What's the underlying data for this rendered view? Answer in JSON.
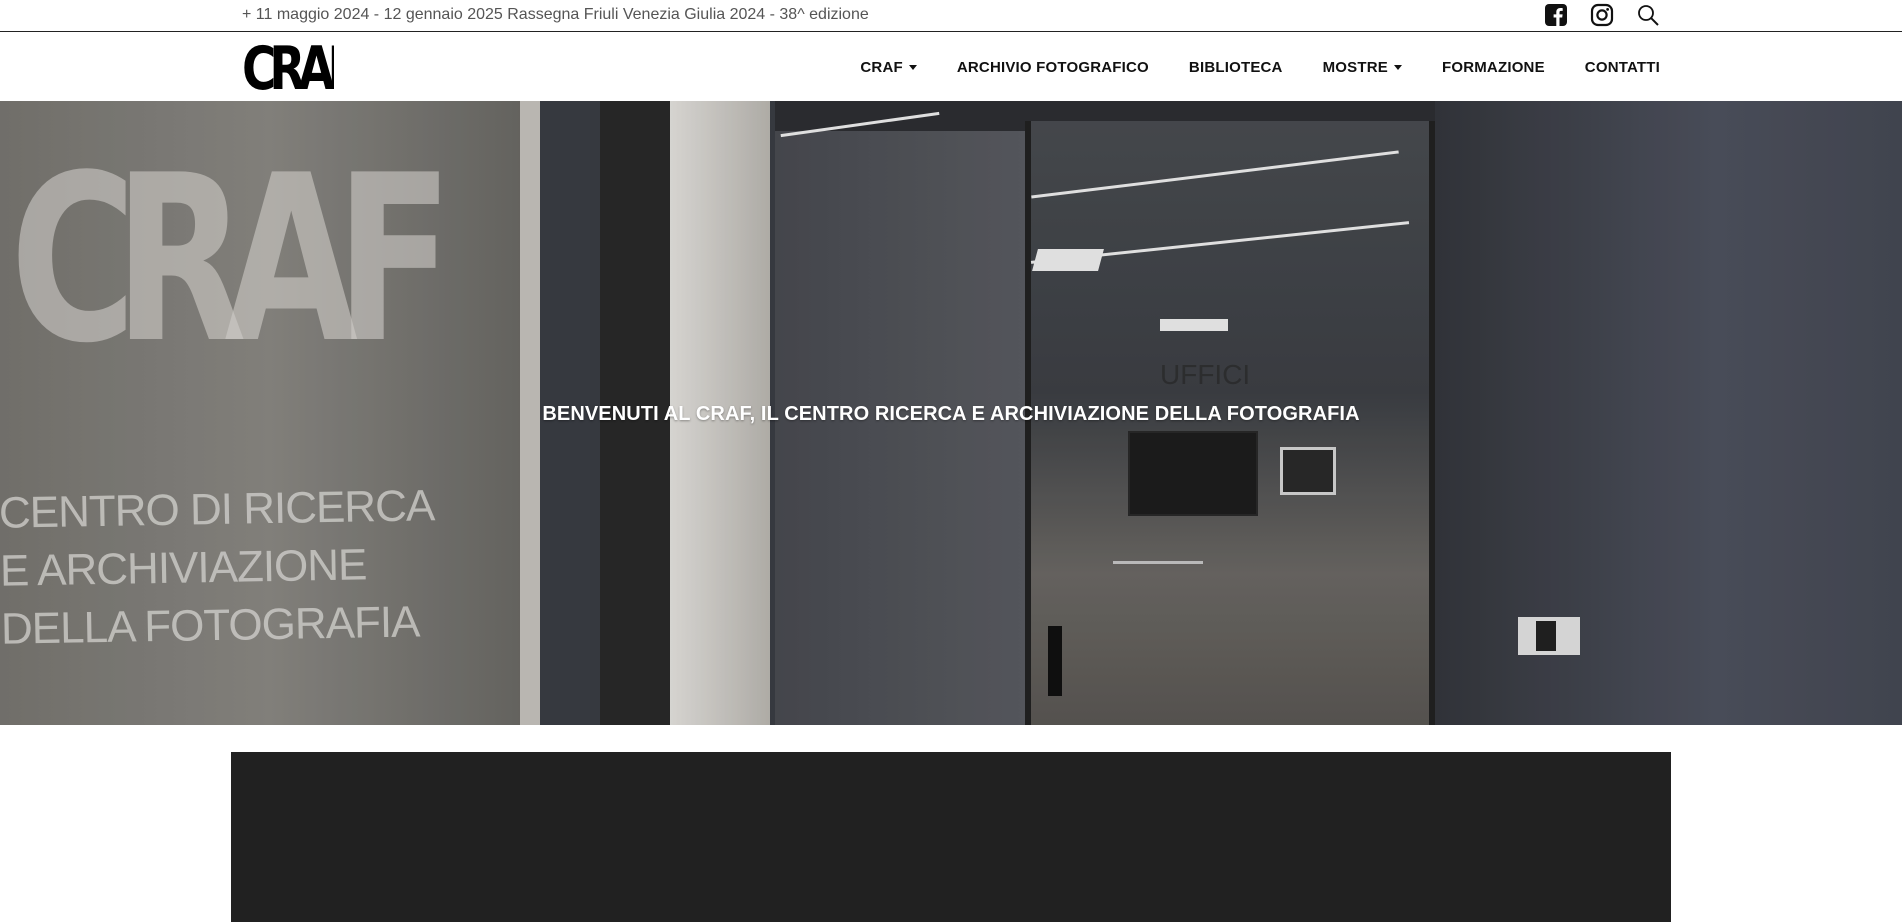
{
  "topbar": {
    "ticker": "+ 11 maggio 2024 - 12 gennaio 2025 Rassegna Friuli Venezia Giulia 2024 - 38^ edizione",
    "social": [
      {
        "icon": "facebook-icon"
      },
      {
        "icon": "instagram-icon"
      },
      {
        "icon": "search-icon"
      }
    ]
  },
  "navbar": {
    "logo": "CRAF",
    "menu": [
      {
        "label": "CRAF",
        "dropdown": true
      },
      {
        "label": "ARCHIVIO FOTOGRAFICO",
        "dropdown": false
      },
      {
        "label": "BIBLIOTECA",
        "dropdown": false
      },
      {
        "label": "MOSTRE",
        "dropdown": true
      },
      {
        "label": "FORMAZIONE",
        "dropdown": false
      },
      {
        "label": "CONTATTI",
        "dropdown": false
      }
    ]
  },
  "hero": {
    "headline": "BENVENUTI AL CRAF, IL CENTRO RICERCA E ARCHIVIAZIONE DELLA FOTOGRAFIA",
    "wall_logo": "CRAF",
    "wall_text": [
      "CENTRO DI RICERCA",
      "E ARCHIVIAZIONE",
      "DELLA FOTOGRAFIA"
    ],
    "office_sign": "UFFICI"
  },
  "colors": {
    "video_bg": "#212121",
    "text_dark": "#111111",
    "ticker": "#555555"
  }
}
